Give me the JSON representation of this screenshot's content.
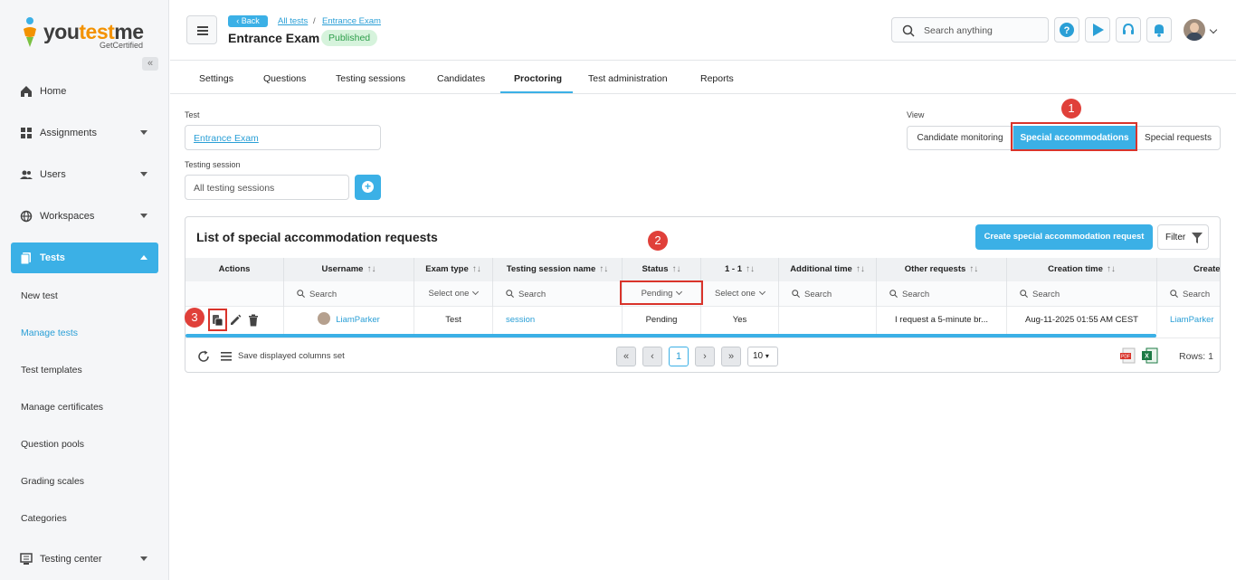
{
  "app": {
    "logo_you": "you",
    "logo_test": "test",
    "logo_me": "me",
    "logo_tag": "GetCertified",
    "collapse_icon": "«"
  },
  "sidebar": {
    "items": [
      {
        "label": "Home",
        "icon": "home-icon"
      },
      {
        "label": "Assignments",
        "icon": "assignments-icon"
      },
      {
        "label": "Users",
        "icon": "users-icon"
      },
      {
        "label": "Workspaces",
        "icon": "globe-icon"
      },
      {
        "label": "Tests",
        "icon": "tests-icon"
      }
    ],
    "sub_items": [
      "New test",
      "Manage tests",
      "Test templates",
      "Manage certificates",
      "Question pools",
      "Grading scales",
      "Categories"
    ],
    "testing_center": "Testing center"
  },
  "header": {
    "back": "Back",
    "crumb_all_tests": "All tests",
    "crumb_sep": "/",
    "crumb_exam": "Entrance Exam",
    "title": "Entrance Exam",
    "status_badge": "Published",
    "search_placeholder": "Search anything"
  },
  "tabs": [
    "Settings",
    "Questions",
    "Testing sessions",
    "Candidates",
    "Proctoring",
    "Test administration",
    "Reports"
  ],
  "filters": {
    "test_label": "Test",
    "test_value": "Entrance Exam",
    "session_label": "Testing session",
    "session_placeholder": "All testing sessions",
    "view_label": "View",
    "view_options": [
      "Candidate monitoring",
      "Special accommodations",
      "Special requests"
    ]
  },
  "steps": [
    "1",
    "2",
    "3"
  ],
  "panel": {
    "title": "List of special accommodation requests",
    "create_button": "Create special accommodation request",
    "filter_button": "Filter",
    "columns": [
      "Actions",
      "Username",
      "Exam type",
      "Testing session name",
      "Status",
      "1 - 1",
      "Additional time",
      "Other requests",
      "Creation time",
      "Create"
    ],
    "sort_glyph": "↑↓",
    "filter_row": {
      "search": "Search",
      "select_one": "Select one",
      "status_value": "Pending"
    },
    "row": {
      "username": "LiamParker",
      "exam_type": "Test",
      "session": "session",
      "status": "Pending",
      "one_to_one": "Yes",
      "additional_time": "",
      "other_requests": "I request a 5-minute br...",
      "creation_time": "Aug-11-2025 01:55 AM CEST",
      "creator": "LiamParker"
    },
    "footer": {
      "save_columns": "Save displayed columns set",
      "first": "«",
      "prev": "‹",
      "page": "1",
      "next": "›",
      "last": "»",
      "page_size": "10",
      "rows": "Rows: 1"
    }
  },
  "colors": {
    "accent": "#3bb0e6",
    "marker": "#e0403a",
    "published_bg": "#d6f3dc",
    "published_fg": "#2e9e4b"
  }
}
